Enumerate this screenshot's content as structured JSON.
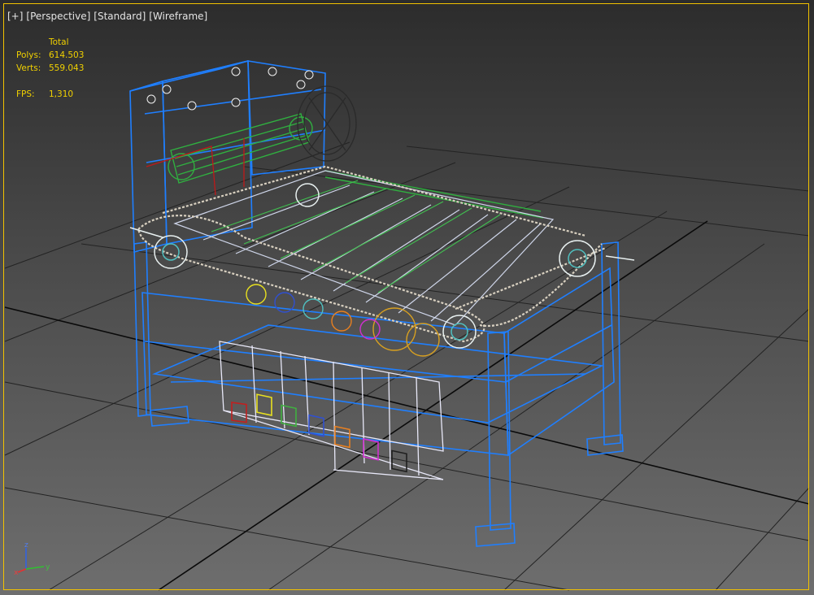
{
  "viewport": {
    "labels": [
      "[+]",
      "[Perspective]",
      "[Standard]",
      "[Wireframe]"
    ]
  },
  "stats": {
    "header": "Total",
    "polys_label": "Polys:",
    "polys_value": "614.503",
    "verts_label": "Verts:",
    "verts_value": "559.043",
    "fps_label": "FPS:",
    "fps_value": "1,310"
  },
  "gizmo": {
    "x": "x",
    "y": "y",
    "z": "z"
  },
  "colors": {
    "frame": "#1f7fff",
    "chain": "#d8d0c0",
    "roller": "#30b040",
    "stats_text": "#f0d000",
    "active_border": "#f2c200"
  },
  "icons": {
    "gizmo": "axis-tripod-icon"
  }
}
